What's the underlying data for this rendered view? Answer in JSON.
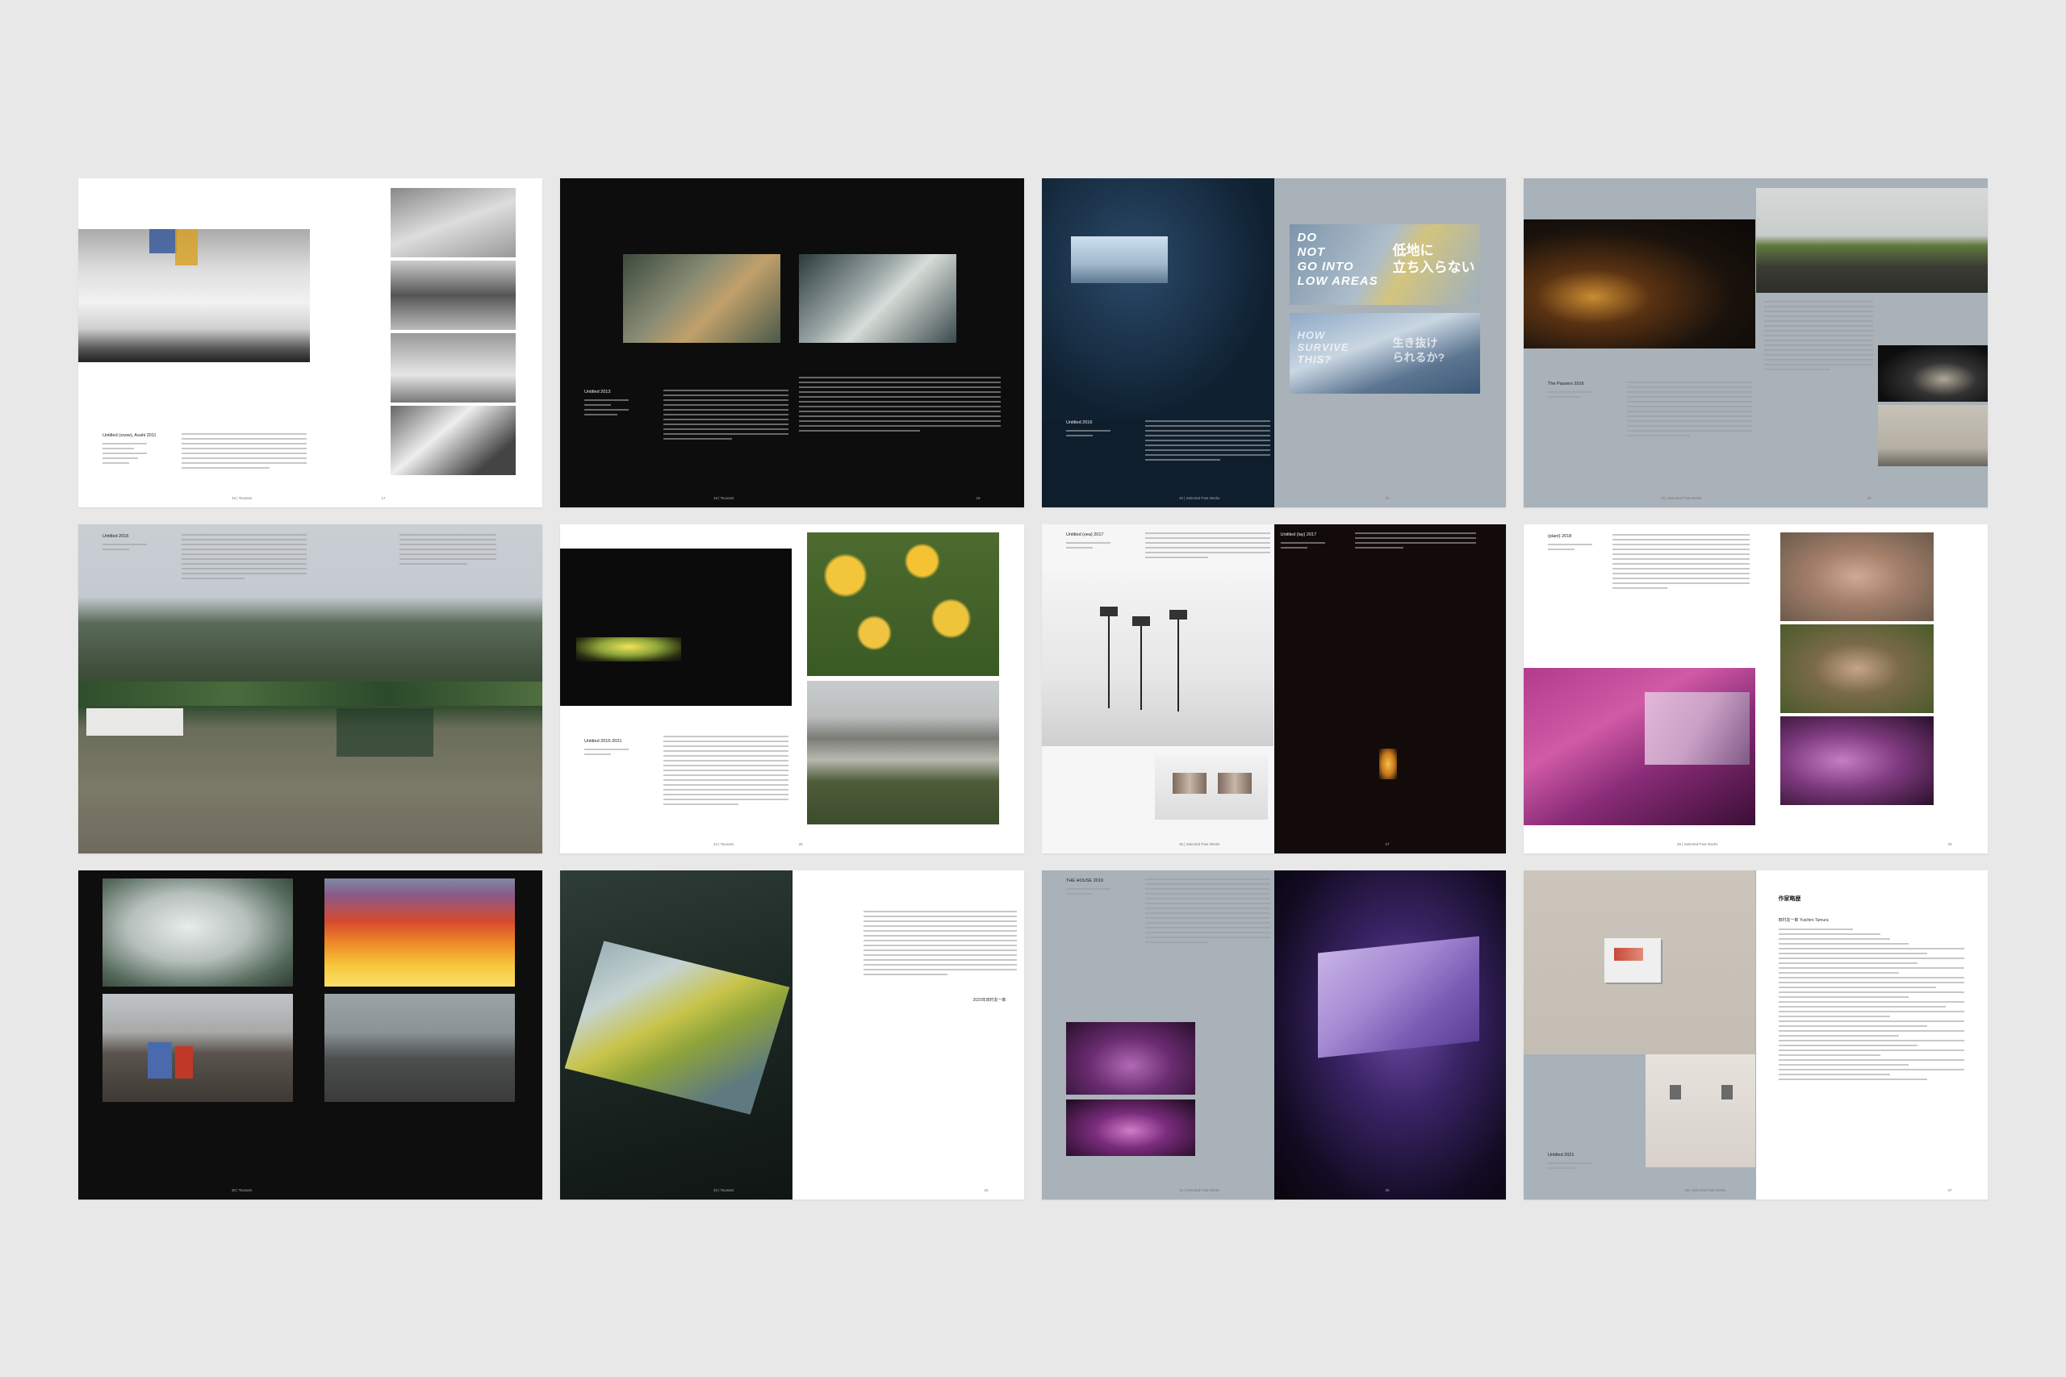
{
  "spreads": [
    {
      "caption": "Untitled (snow), Asahi 2011",
      "folio_left": "16  |  Tsunami",
      "folio_right": "17"
    },
    {
      "caption": "Untitled 2013",
      "folio_left": "18  |  Tsunami",
      "folio_right": "19"
    },
    {
      "caption": "Untitled 2016",
      "folio_left": "20  |  Selected Past Works",
      "folio_right": "21",
      "poster_en": "DO\nNOT\nGO INTO\nLOW AREAS",
      "poster_jp": "低地に\n立ち入らない",
      "poster2_en": "HOW\nSURVIVE\nTHIS?",
      "poster2_jp": "生き抜け\nられるか?"
    },
    {
      "caption": "The Passers 2016",
      "folio_left": "22  |  Selected Past Works",
      "folio_right": "23"
    },
    {
      "caption": "Untitled 2016",
      "folio_left": "",
      "folio_right": ""
    },
    {
      "caption": "Untitled 2015-2021",
      "folio_left": "24  |  Tsunami",
      "folio_right": "25"
    },
    {
      "caption": "Untitled (sea) 2017",
      "caption2": "Untitled (lay) 2017",
      "folio_left": "26  |  Selected Past Works",
      "folio_right": "27"
    },
    {
      "caption": "(plant) 2018",
      "folio_left": "28  |  Selected Past Works",
      "folio_right": "29"
    },
    {
      "folio_left": "30  |  Tsunami",
      "folio_right": ""
    },
    {
      "folio_left": "32  |  Tsunami",
      "folio_right": "33",
      "signature": "2020年田村友一郎"
    },
    {
      "caption": "THE HOUSE 2019",
      "folio_left": "34  |  Selected Past Works",
      "folio_right": "35"
    },
    {
      "caption": "Untitled 2021",
      "folio_left": "36  |  Selected Past Works",
      "folio_right": "37",
      "bio_title": "作家略歴",
      "bio_name": "田村友一郎 Yuichiro Tamura"
    }
  ]
}
